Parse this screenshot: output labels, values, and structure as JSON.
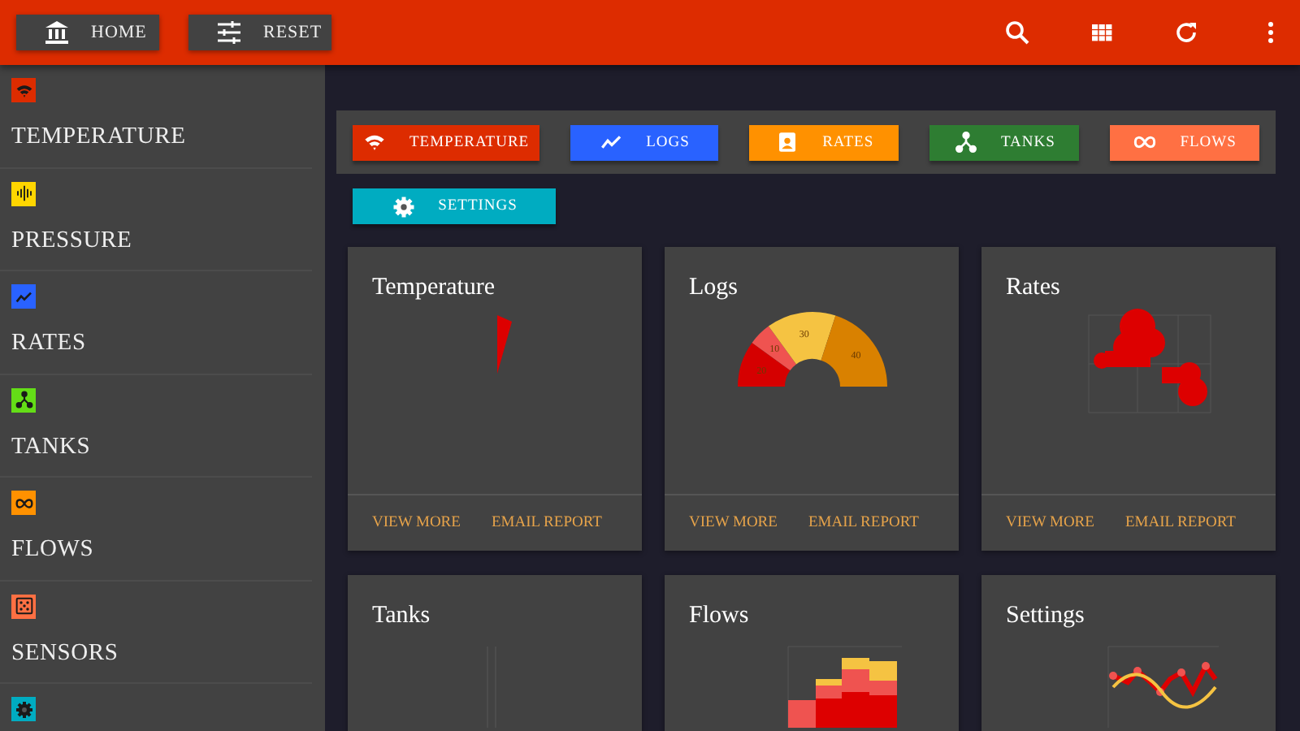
{
  "topbar": {
    "buttons": [
      {
        "label": "HOME"
      },
      {
        "label": "RESET"
      }
    ]
  },
  "sidebar": {
    "items": [
      {
        "label": "TEMPERATURE",
        "color": "#dd2c00"
      },
      {
        "label": "PRESSURE",
        "color": "#ffd600"
      },
      {
        "label": "RATES",
        "color": "#2962ff"
      },
      {
        "label": "TANKS",
        "color": "#64dd17"
      },
      {
        "label": "FLOWS",
        "color": "#ff9100"
      },
      {
        "label": "SENSORS",
        "color": "#ff7043"
      },
      {
        "color": "#00acc1"
      }
    ]
  },
  "quick_buttons": [
    {
      "label": "TEMPERATURE",
      "color": "#dd2c00"
    },
    {
      "label": "LOGS",
      "color": "#2962ff"
    },
    {
      "label": "RATES",
      "color": "#ff9100"
    },
    {
      "label": "TANKS",
      "color": "#2e7d32"
    },
    {
      "label": "FLOWS",
      "color": "#ff7043"
    },
    {
      "label": "SETTINGS",
      "color": "#00acc1"
    }
  ],
  "cards": [
    {
      "title": "Temperature",
      "kind": "wedge",
      "actions": [
        "VIEW MORE",
        "EMAIL REPORT"
      ]
    },
    {
      "title": "Logs",
      "kind": "gauge",
      "chart_data": {
        "type": "donut",
        "values": [
          20,
          10,
          30,
          40
        ],
        "data_labels": true
      },
      "actions": [
        "VIEW MORE",
        "EMAIL REPORT"
      ]
    },
    {
      "title": "Rates",
      "kind": "blobs",
      "actions": [
        "VIEW MORE",
        "EMAIL REPORT"
      ]
    },
    {
      "title": "Tanks",
      "kind": "axes"
    },
    {
      "title": "Flows",
      "kind": "stacked"
    },
    {
      "title": "Settings",
      "kind": "lines"
    }
  ]
}
